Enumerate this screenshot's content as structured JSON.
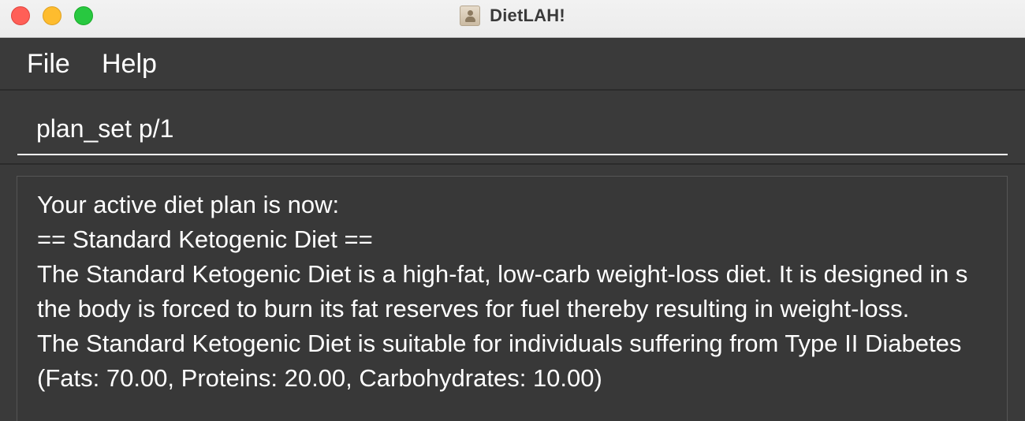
{
  "window": {
    "title": "DietLAH!",
    "app_icon": "person-card-icon"
  },
  "menu": {
    "items": [
      "File",
      "Help"
    ]
  },
  "command": {
    "value": "plan_set p/1"
  },
  "result": {
    "lines": [
      "Your active diet plan is now:",
      "== Standard Ketogenic Diet ==",
      "The Standard Ketogenic Diet is a high-fat, low-carb weight-loss diet. It is designed in s",
      "the body is forced to burn its fat reserves for fuel thereby resulting in weight-loss.",
      "The Standard Ketogenic Diet is suitable for individuals suffering from Type II Diabetes",
      "(Fats: 70.00, Proteins: 20.00, Carbohydrates: 10.00)"
    ]
  },
  "colors": {
    "background": "#3a3a3a",
    "text": "#ffffff",
    "close": "#ff5f57",
    "minimize": "#febc2e",
    "maximize": "#28c840"
  }
}
